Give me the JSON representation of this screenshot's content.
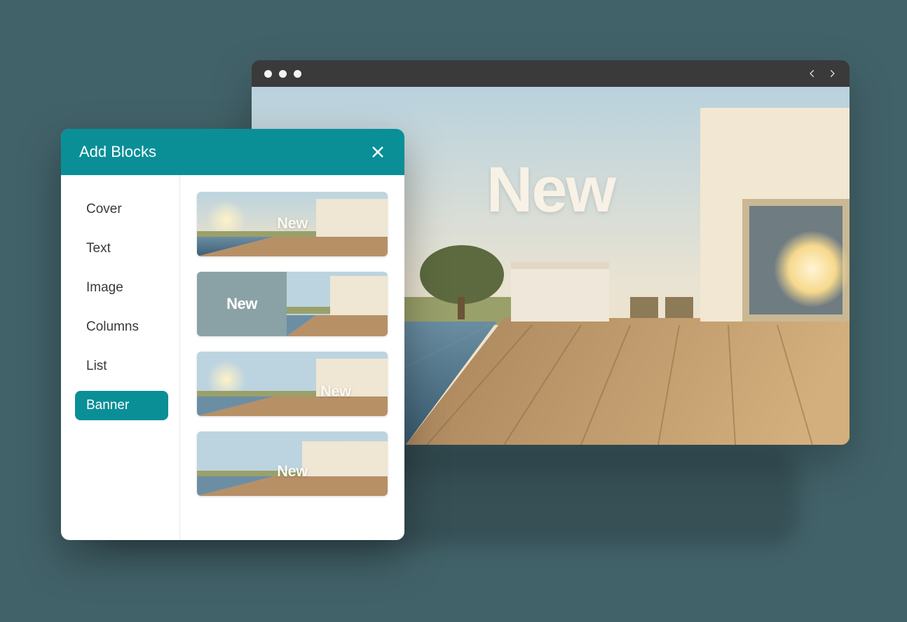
{
  "panel": {
    "title": "Add Blocks",
    "categories": [
      {
        "label": "Cover",
        "active": false
      },
      {
        "label": "Text",
        "active": false
      },
      {
        "label": "Image",
        "active": false
      },
      {
        "label": "Columns",
        "active": false
      },
      {
        "label": "List",
        "active": false
      },
      {
        "label": "Banner",
        "active": true
      }
    ],
    "previews": [
      {
        "variant": "v1",
        "label": "New"
      },
      {
        "variant": "v2",
        "label": "New"
      },
      {
        "variant": "v3",
        "label": "New"
      },
      {
        "variant": "v4",
        "label": "New"
      }
    ]
  },
  "hero": {
    "label": "New"
  },
  "colors": {
    "teal": "#0a8f97",
    "bg": "#426269"
  }
}
